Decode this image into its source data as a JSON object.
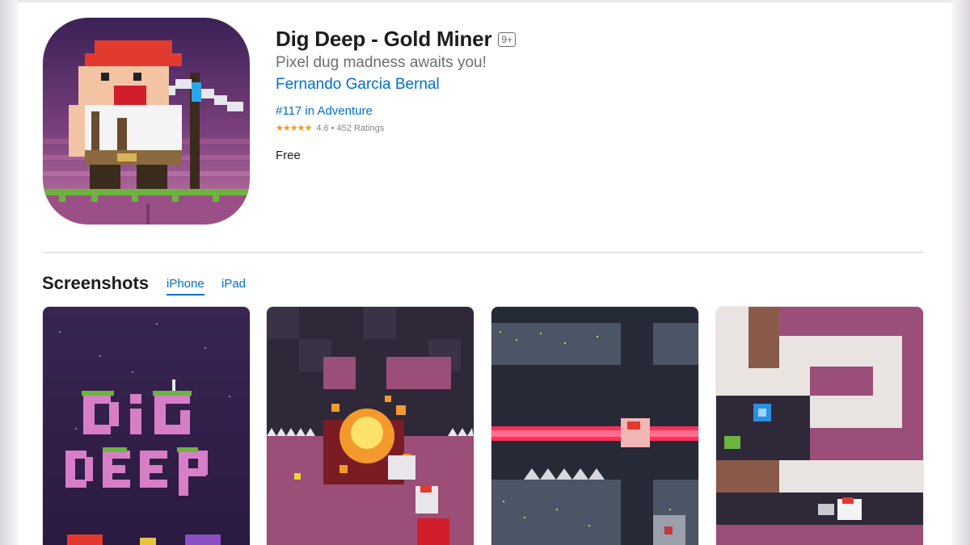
{
  "app": {
    "title": "Dig Deep - Gold Miner",
    "age_rating": "9+",
    "subtitle": "Pixel dug madness awaits you!",
    "developer": "Fernando Garcia Bernal",
    "rank": "#117 in Adventure",
    "stars_glyph": "★★★★★",
    "rating_text": "4.6 • 452 Ratings",
    "price": "Free",
    "icon": "pixel-miner-app-icon"
  },
  "screenshots": {
    "heading": "Screenshots",
    "tabs": [
      {
        "label": "iPhone",
        "selected": true
      },
      {
        "label": "iPad",
        "selected": false
      }
    ]
  },
  "colors": {
    "link": "#0070c9",
    "star": "#ff9500",
    "title": "#1d1d1f",
    "secondary": "#6e6e73"
  }
}
